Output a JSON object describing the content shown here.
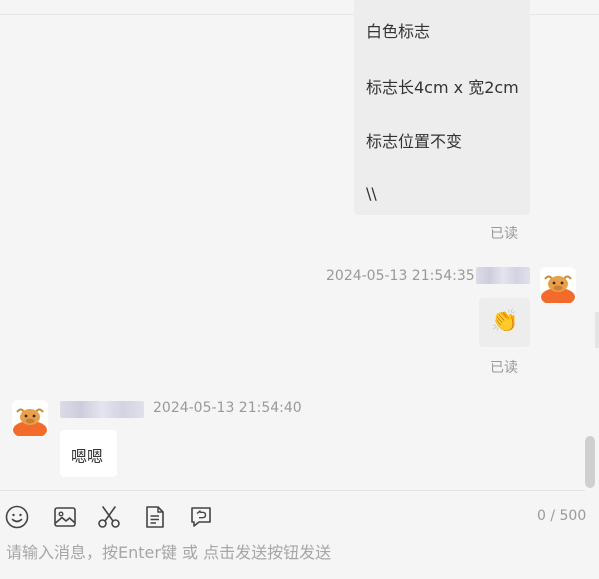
{
  "messages": {
    "first": {
      "lines": [
        "白色标志",
        "标志长4cm x 宽2cm",
        "标志位置不变",
        "\\\\"
      ],
      "status": "已读"
    },
    "second": {
      "timestamp": "2024-05-13 21:54:35",
      "emoji": "👏",
      "status": "已读"
    },
    "third": {
      "timestamp": "2024-05-13 21:54:40",
      "text": "嗯嗯"
    }
  },
  "toolbar": {
    "icons": [
      "emoji-icon",
      "image-icon",
      "scissors-icon",
      "document-icon",
      "feedback-icon"
    ],
    "counter": "0 / 500"
  },
  "composer": {
    "placeholder": "请输入消息，按Enter键 或 点击发送按钮发送"
  },
  "colors": {
    "background": "#f5f5f5",
    "bubble": "#ededed",
    "avatar_orange": "#f26b2b"
  }
}
